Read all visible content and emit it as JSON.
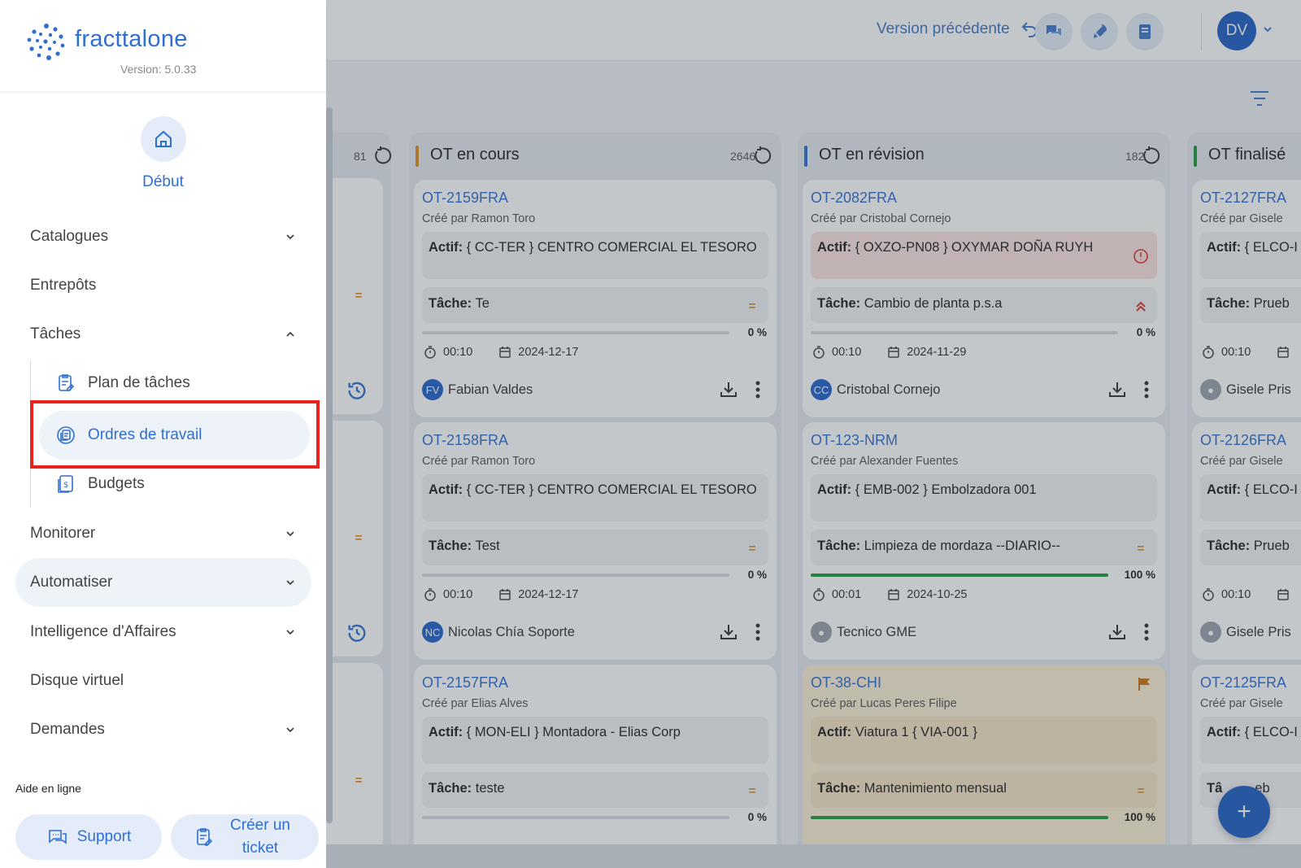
{
  "topbar": {
    "prev_version": "Version précédente",
    "avatar_initials": "DV"
  },
  "board": {
    "left_count": "81",
    "columns": [
      {
        "title": "OT en cours",
        "count": "2646",
        "accent": "#e08a1e",
        "cards": [
          {
            "code": "OT-2159FRA",
            "created": "Créé par Ramon Toro",
            "asset_label": "Actif:",
            "asset": "{ CC-TER } CENTRO COMERCIAL EL TESORO",
            "task_label": "Tâche:",
            "task": "Te",
            "prio": "=",
            "progress": 0,
            "pct": "0 %",
            "time": "00:10",
            "date": "2024-12-17",
            "assignee_initials": "FV",
            "assignee": "Fabian Valdes"
          },
          {
            "code": "OT-2158FRA",
            "created": "Créé par Ramon Toro",
            "asset_label": "Actif:",
            "asset": "{ CC-TER } CENTRO COMERCIAL EL TESORO",
            "task_label": "Tâche:",
            "task": "Test",
            "prio": "=",
            "progress": 0,
            "pct": "0 %",
            "time": "00:10",
            "date": "2024-12-17",
            "assignee_initials": "NC",
            "assignee": "Nicolas Chía Soporte"
          },
          {
            "code": "OT-2157FRA",
            "created": "Créé par Elias Alves",
            "asset_label": "Actif:",
            "asset": "{ MON-ELI } Montadora - Elias Corp",
            "task_label": "Tâche:",
            "task": "teste",
            "prio": "=",
            "progress": 0,
            "pct": "0 %"
          }
        ]
      },
      {
        "title": "OT en révision",
        "count": "182",
        "accent": "#2f6fd1",
        "cards": [
          {
            "code": "OT-2082FRA",
            "created": "Créé par Cristobal Cornejo",
            "asset_label": "Actif:",
            "asset": "{ OXZO-PN08 } OXYMAR DOÑA RUYH",
            "task_label": "Tâche:",
            "task": "Cambio de planta p.s.a",
            "prio": "^",
            "progress": 0,
            "pct": "0 %",
            "time": "00:10",
            "date": "2024-11-29",
            "assignee_initials": "CC",
            "assignee": "Cristobal Cornejo"
          },
          {
            "code": "OT-123-NRM",
            "created": "Créé par Alexander Fuentes",
            "asset_label": "Actif:",
            "asset": "{ EMB-002 } Embolzadora 001",
            "task_label": "Tâche:",
            "task": "Limpieza de mordaza --DIARIO--",
            "prio": "=",
            "progress": 100,
            "pct": "100 %",
            "time": "00:01",
            "date": "2024-10-25",
            "assignee": "Tecnico GME"
          },
          {
            "code": "OT-38-CHI",
            "created": "Créé par Lucas Peres Filipe",
            "asset_label": "Actif:",
            "asset": "Viatura 1  { VIA-001 }",
            "task_label": "Tâche:",
            "task": "Mantenimiento mensual",
            "prio": "=",
            "progress": 100,
            "pct": "100 %"
          }
        ]
      },
      {
        "title": "OT finalisé",
        "accent": "#1e9b3a",
        "cards": [
          {
            "code": "OT-2127FRA",
            "created": "Créé par Gisele",
            "asset_label": "Actif:",
            "asset": "{ ELCO-I",
            "task_label": "Tâche:",
            "task": "Prueb",
            "time": "00:10",
            "assignee": "Gisele Pris"
          },
          {
            "code": "OT-2126FRA",
            "created": "Créé par Gisele",
            "asset_label": "Actif:",
            "asset": "{ ELCO-I",
            "task_label": "Tâche:",
            "task": "Prueb",
            "time": "00:10",
            "assignee": "Gisele Pris"
          },
          {
            "code": "OT-2125FRA",
            "created": "Créé par Gisele",
            "asset_label": "Actif:",
            "asset": "{ ELCO-I",
            "task_label": "Tâ",
            "task": "eb"
          }
        ]
      }
    ],
    "fab_label": "+"
  },
  "sidebar": {
    "logo": "fracttalone",
    "version": "Version: 5.0.33",
    "home": "Début",
    "items": [
      {
        "label": "Catalogues",
        "chevron": "down"
      },
      {
        "label": "Entrepôts"
      },
      {
        "label": "Tâches",
        "chevron": "up"
      },
      {
        "label": "Monitorer",
        "chevron": "down"
      },
      {
        "label": "Automatiser",
        "chevron": "down"
      },
      {
        "label": "Intelligence d'Affaires",
        "chevron": "down"
      },
      {
        "label": "Disque virtuel"
      },
      {
        "label": "Demandes",
        "chevron": "down"
      }
    ],
    "sub_items": [
      {
        "label": "Plan de tâches",
        "icon": "clipboard-icon"
      },
      {
        "label": "Ordres de travail",
        "icon": "work-orders-icon",
        "active": true
      },
      {
        "label": "Budgets",
        "icon": "budget-icon"
      }
    ],
    "help_label": "Aide en ligne",
    "support_label": "Support",
    "ticket_label": "Créer un ticket"
  },
  "colors": {
    "brand": "#2f6fd1",
    "highlight_box": "#e8231b",
    "fab": "#1f5fc4"
  }
}
